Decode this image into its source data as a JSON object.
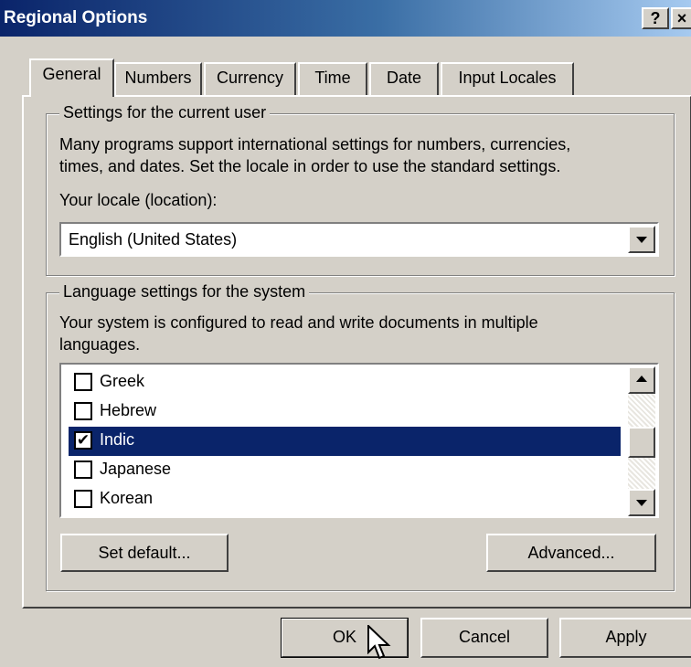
{
  "window": {
    "title": "Regional Options",
    "help_label": "?",
    "close_label": "×"
  },
  "tabs": [
    {
      "label": "General",
      "active": true
    },
    {
      "label": "Numbers"
    },
    {
      "label": "Currency"
    },
    {
      "label": "Time"
    },
    {
      "label": "Date"
    },
    {
      "label": "Input Locales"
    }
  ],
  "current_user": {
    "legend": "Settings for the current user",
    "description_line1": "Many programs support international settings for numbers, currencies,",
    "description_line2": "times, and dates. Set the locale in order to use the standard settings.",
    "locale_label": "Your locale (location):",
    "locale_value": "English (United States)"
  },
  "system_language": {
    "legend": "Language settings for the system",
    "description_line1": "Your system is configured to read and write documents in multiple",
    "description_line2": "languages.",
    "items": [
      {
        "label": "Greek",
        "checked": false
      },
      {
        "label": "Hebrew",
        "checked": false
      },
      {
        "label": "Indic",
        "checked": true,
        "selected": true
      },
      {
        "label": "Japanese",
        "checked": false
      },
      {
        "label": "Korean",
        "checked": false
      }
    ],
    "set_default_label": "Set default...",
    "advanced_label": "Advanced..."
  },
  "buttons": {
    "ok": "OK",
    "cancel": "Cancel",
    "apply": "Apply"
  },
  "check_mark": "✔",
  "colors": {
    "selection": "#0a246a",
    "dialog_face": "#d4d0c8"
  }
}
